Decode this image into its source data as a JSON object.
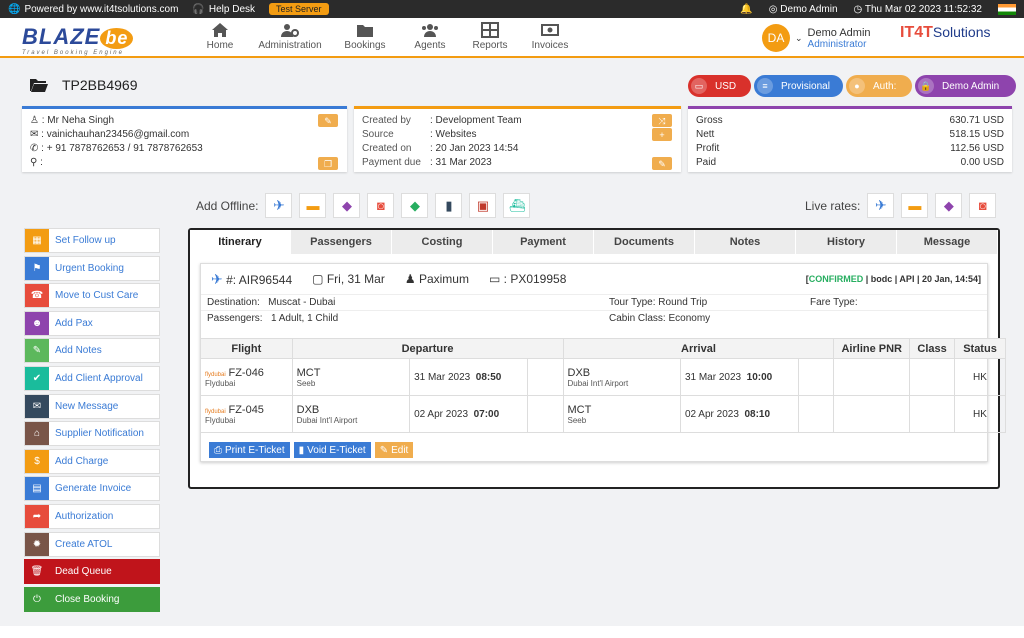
{
  "topbar": {
    "powered": "Powered by www.it4tsolutions.com",
    "help": "Help Desk",
    "server": "Test Server",
    "user": "Demo Admin",
    "datetime": "Thu Mar 02 2023 11:52:32"
  },
  "header": {
    "logo": "BLAZE",
    "logo_be": "be",
    "logo_tag": "Travel Booking Engine",
    "nav": [
      "Home",
      "Administration",
      "Bookings",
      "Agents",
      "Reports",
      "Invoices"
    ],
    "avatar": "DA",
    "user_name": "Demo Admin",
    "user_role": "Administrator",
    "partner_logo": "IT4T",
    "partner_logo_suffix": "Solutions"
  },
  "booking": {
    "ref": "TP2BB4969"
  },
  "pills": [
    {
      "label": "USD",
      "color": "#d9312b"
    },
    {
      "label": "Provisional",
      "color": "#3a7bd5"
    },
    {
      "label": "Auth:",
      "color": "#f0ad4e"
    },
    {
      "label": "Demo Admin",
      "color": "#8e44ad"
    }
  ],
  "customer": {
    "name": ": Mr Neha Singh",
    "email": ": vainichauhan23456@gmail.com",
    "phone": ": + 91 7878762653 / 91 7878762653",
    "location": ":"
  },
  "meta": {
    "rows": [
      {
        "k": "Created by",
        "v": ": Development Team"
      },
      {
        "k": "Source",
        "v": ": Websites"
      },
      {
        "k": "Created on",
        "v": ": 20 Jan 2023 14:54"
      },
      {
        "k": "Payment due",
        "v": ": 31 Mar 2023"
      }
    ]
  },
  "totals": {
    "rows": [
      {
        "k": "Gross",
        "v": "630.71 USD"
      },
      {
        "k": "Nett",
        "v": "518.15 USD"
      },
      {
        "k": "Profit",
        "v": "112.56 USD"
      },
      {
        "k": "Paid",
        "v": "0.00 USD"
      }
    ]
  },
  "offline_label": "Add Offline:",
  "live_label": "Live rates:",
  "sidebar": [
    {
      "label": "Set Follow up",
      "color": "#f39c12",
      "icon": "▦"
    },
    {
      "label": "Urgent Booking",
      "color": "#3a7bd5",
      "icon": "⚑"
    },
    {
      "label": "Move to Cust Care",
      "color": "#e74c3c",
      "icon": "☎"
    },
    {
      "label": "Add Pax",
      "color": "#8e44ad",
      "icon": "☻"
    },
    {
      "label": "Add Notes",
      "color": "#5cb85c",
      "icon": "✎"
    },
    {
      "label": "Add Client Approval",
      "color": "#1abc9c",
      "icon": "✔"
    },
    {
      "label": "New Message",
      "color": "#34495e",
      "icon": "✉"
    },
    {
      "label": "Supplier Notification",
      "color": "#795548",
      "icon": "⌂"
    },
    {
      "label": "Add Charge",
      "color": "#f39c12",
      "icon": "$"
    },
    {
      "label": "Generate Invoice",
      "color": "#3a7bd5",
      "icon": "▤"
    },
    {
      "label": "Authorization",
      "color": "#e74c3c",
      "icon": "➦"
    },
    {
      "label": "Create ATOL",
      "color": "#795548",
      "icon": "✹"
    }
  ],
  "dead_queue": "Dead Queue",
  "close_booking": "Close Booking",
  "tabs": [
    "Itinerary",
    "Passengers",
    "Costing",
    "Payment",
    "Documents",
    "Notes",
    "History",
    "Message"
  ],
  "flight": {
    "ref": "#: AIR96544",
    "date": "Fri, 31 Mar",
    "supplier": "Paximum",
    "pnr": ": PX019958",
    "status_code": "CONFIRMED",
    "status_rest": " | bodc | API | 20 Jan, 14:54]",
    "status_open": "[",
    "destination_label": "Destination:",
    "destination": "Muscat - Dubai",
    "tour_label": "Tour Type:",
    "tour": "Round Trip",
    "fare_label": "Fare Type:",
    "pass_label": "Passengers:",
    "passengers": "1 Adult, 1 Child",
    "cabin_label": "Cabin Class:",
    "cabin": "Economy"
  },
  "table": {
    "headers": [
      "Flight",
      "Departure",
      "Arrival",
      "Airline PNR",
      "Class",
      "Status"
    ],
    "rows": [
      {
        "airline_logo": "flydubai",
        "flight": "FZ-046",
        "airline": "Flydubai",
        "dep_code": "MCT",
        "dep_name": "Seeb",
        "dep_date": "31 Mar 2023",
        "dep_time": "08:50",
        "arr_code": "DXB",
        "arr_name": "Dubai Int'l Airport",
        "arr_date": "31 Mar 2023",
        "arr_time": "10:00",
        "status": "HK"
      },
      {
        "airline_logo": "flydubai",
        "flight": "FZ-045",
        "airline": "Flydubai",
        "dep_code": "DXB",
        "dep_name": "Dubai Int'l Airport",
        "dep_date": "02 Apr 2023",
        "dep_time": "07:00",
        "arr_code": "MCT",
        "arr_name": "Seeb",
        "arr_date": "02 Apr 2023",
        "arr_time": "08:10",
        "status": "HK"
      }
    ]
  },
  "buttons": {
    "print": "Print E-Ticket",
    "void": "Void E-Ticket",
    "edit": "Edit"
  }
}
